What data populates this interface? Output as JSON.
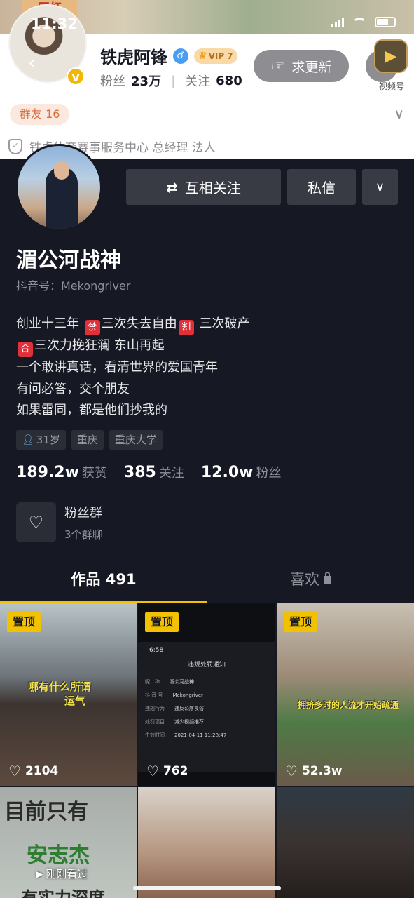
{
  "status_bar": {
    "time": "11:32"
  },
  "banner_tag": "网红",
  "header": {
    "name": "铁虎阿锋",
    "vip_label": "VIP 7",
    "fans_label": "粉丝",
    "fans_value": "23万",
    "following_label": "关注",
    "following_value": "680",
    "request_update_label": "求更新",
    "more_label": "···",
    "video_channel_label": "视频号",
    "group_chip": "群友 16",
    "company": "铁虎体育赛事服务中心 总经理 法人"
  },
  "actions": {
    "mutual_follow_label": "互相关注",
    "message_label": "私信"
  },
  "profile": {
    "name": "湄公河战神",
    "douyin_id": "抖音号：Mekongriver",
    "bio": {
      "line1_a": "创业十三年 ",
      "emoji1": "禁",
      "line1_b": "三次失去自由",
      "emoji2": "割",
      "line1_c": " 三次破产",
      "emoji3": "合",
      "line2": "三次力挽狂澜 东山再起",
      "line3": "一个敢讲真话，看清世界的爱国青年",
      "line4": "有问必答，交个朋友",
      "line5": "如果雷同，都是他们抄我的"
    },
    "tags": [
      "31岁",
      "重庆",
      "重庆大学"
    ],
    "stats": {
      "likes_value": "189.2w",
      "likes_label": "获赞",
      "following_value": "385",
      "following_label": "关注",
      "fans_value": "12.0w",
      "fans_label": "粉丝"
    },
    "fan_group": {
      "title": "粉丝群",
      "subtitle": "3个群聊"
    }
  },
  "tabs": {
    "works_label": "作品 491",
    "likes_label": "喜欢"
  },
  "videos": [
    {
      "pinned": "置顶",
      "likes": "2104",
      "caption_a": "哪有什么所谓",
      "caption_b": "运气"
    },
    {
      "pinned": "置顶",
      "likes": "762",
      "notice_time": "6:58",
      "notice_title": "违规处罚通知",
      "rows": [
        {
          "k": "昵　称",
          "v": "湄公河战神"
        },
        {
          "k": "抖 音 号",
          "v": "Mekongriver"
        },
        {
          "k": "违规行为",
          "v": "违反公序良俗"
        },
        {
          "k": "处罚项目",
          "v": "减少视频推荐"
        },
        {
          "k": "生效时间",
          "v": "2021-04-11 11:28:47"
        }
      ]
    },
    {
      "pinned": "置顶",
      "likes": "52.3w",
      "caption": "拥挤多时的人流才开始疏通"
    },
    {
      "text1": "目前只有",
      "text2": "安志杰",
      "text3": "有实力深度",
      "watched": "刚刚看过"
    },
    {},
    {}
  ],
  "colors": {
    "accent": "#f2c100",
    "background": "#161823",
    "button": "#393b44"
  }
}
